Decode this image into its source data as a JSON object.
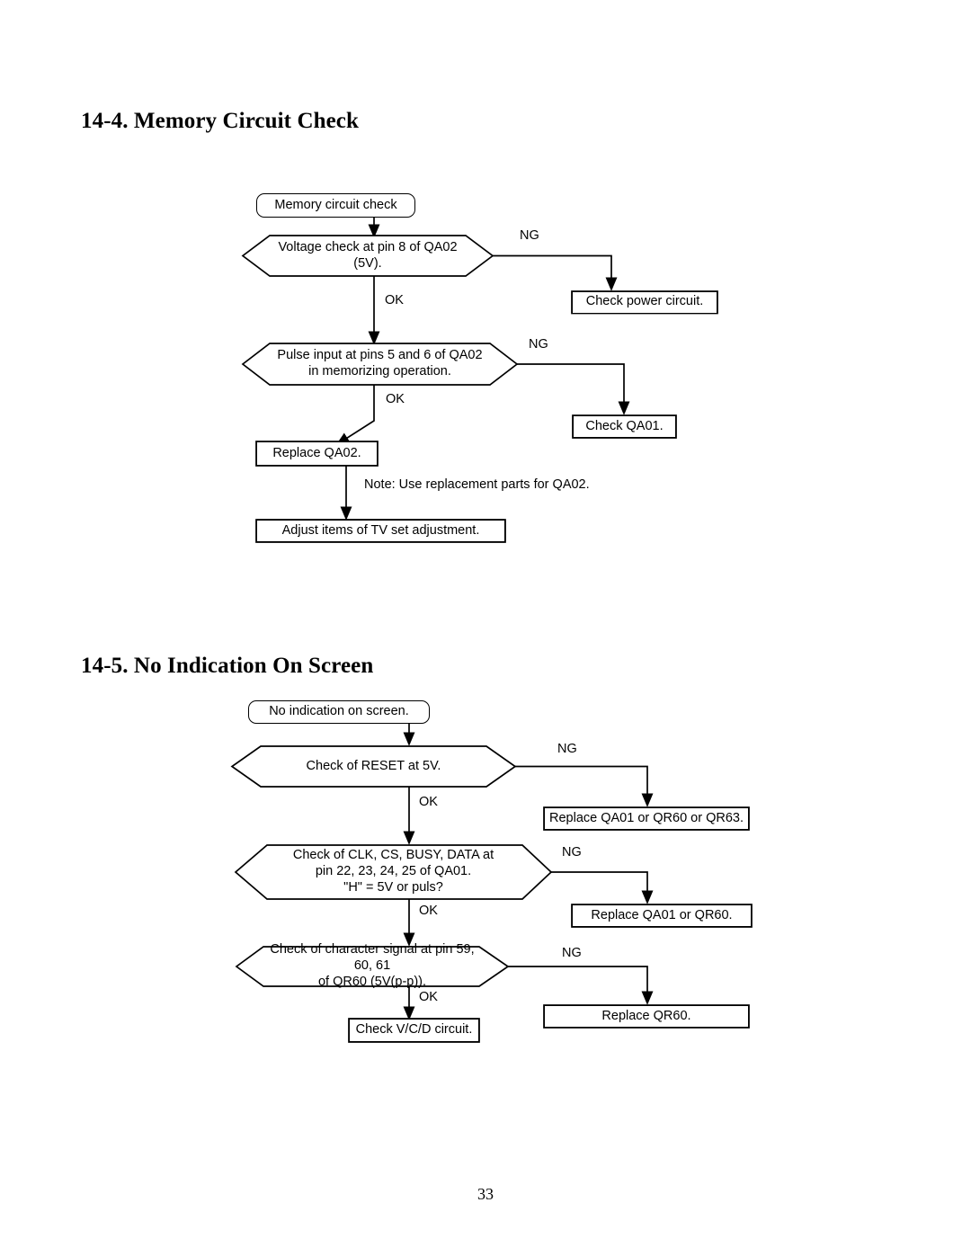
{
  "document": {
    "page_number": "33"
  },
  "sections": [
    {
      "heading": "14-4. Memory Circuit Check",
      "flowchart": {
        "nodes": [
          {
            "id": "mem-start",
            "shape": "rounded",
            "text": "Memory circuit check"
          },
          {
            "id": "mem-d1",
            "shape": "hexagon",
            "text": "Voltage check at pin 8 of QA02 (5V)."
          },
          {
            "id": "mem-power",
            "shape": "rect",
            "text": "Check power circuit."
          },
          {
            "id": "mem-d2",
            "shape": "hexagon",
            "text": "Pulse input at pins 5 and 6 of QA02\nin memorizing operation."
          },
          {
            "id": "mem-qa01",
            "shape": "rect",
            "text": "Check QA01."
          },
          {
            "id": "mem-repl",
            "shape": "rect",
            "text": "Replace QA02."
          },
          {
            "id": "mem-adjust",
            "shape": "rect",
            "text": "Adjust items of TV set adjustment."
          }
        ],
        "edge_labels": [
          {
            "id": "mem-ng1",
            "text": "NG"
          },
          {
            "id": "mem-ok1",
            "text": "OK"
          },
          {
            "id": "mem-ng2",
            "text": "NG"
          },
          {
            "id": "mem-ok2",
            "text": "OK"
          }
        ],
        "notes": [
          {
            "id": "mem-note",
            "text": "Note: Use replacement parts for QA02."
          }
        ]
      }
    },
    {
      "heading": "14-5. No Indication On Screen",
      "flowchart": {
        "nodes": [
          {
            "id": "ni-start",
            "shape": "rounded",
            "text": "No indication on screen."
          },
          {
            "id": "ni-d1",
            "shape": "hexagon",
            "text": "Check of RESET at 5V."
          },
          {
            "id": "ni-r1",
            "shape": "rect",
            "text": "Replace QA01 or QR60 or QR63."
          },
          {
            "id": "ni-d2",
            "shape": "hexagon",
            "text": "Check of CLK, CS, BUSY, DATA at\npin 22, 23, 24, 25 of QA01.\n\"H\" = 5V or puls?"
          },
          {
            "id": "ni-r2",
            "shape": "rect",
            "text": "Replace QA01 or QR60."
          },
          {
            "id": "ni-d3",
            "shape": "hexagon",
            "text": "Check of character signal at pin 59, 60, 61\nof QR60 (5V(p-p))."
          },
          {
            "id": "ni-r3",
            "shape": "rect",
            "text": "Replace QR60."
          },
          {
            "id": "ni-vcd",
            "shape": "rect",
            "text": "Check V/C/D circuit."
          }
        ],
        "edge_labels": [
          {
            "id": "ni-ng1",
            "text": "NG"
          },
          {
            "id": "ni-ok1",
            "text": "OK"
          },
          {
            "id": "ni-ng2",
            "text": "NG"
          },
          {
            "id": "ni-ok2",
            "text": "OK"
          },
          {
            "id": "ni-ng3",
            "text": "NG"
          },
          {
            "id": "ni-ok3",
            "text": "OK"
          }
        ],
        "notes": []
      }
    }
  ]
}
